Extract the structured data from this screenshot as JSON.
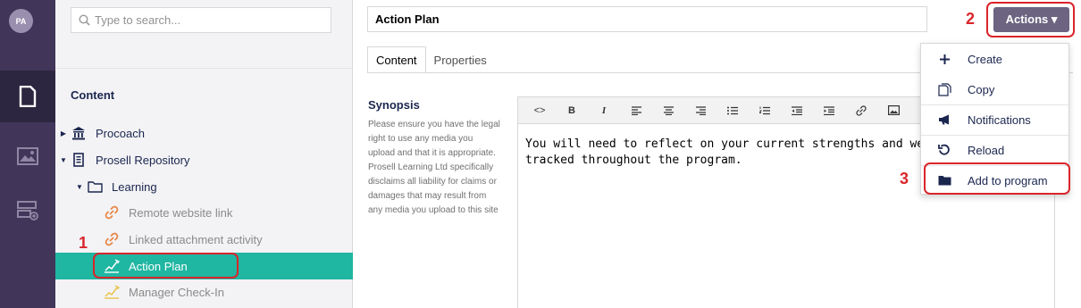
{
  "rail": {
    "avatar_initials": "PA",
    "items": [
      {
        "name": "content-section-icon",
        "active": true
      },
      {
        "name": "media-section-icon",
        "active": false
      },
      {
        "name": "settings-section-icon",
        "active": false
      }
    ]
  },
  "tree": {
    "search_placeholder": "Type to search...",
    "heading": "Content",
    "nodes": [
      {
        "label": "Procoach",
        "icon": "bank-icon"
      },
      {
        "label": "Prosell Repository",
        "icon": "building-icon"
      },
      {
        "label": "Learning",
        "icon": "folder-icon"
      },
      {
        "label": "Remote website link",
        "icon": "link-icon"
      },
      {
        "label": "Linked attachment activity",
        "icon": "link-icon"
      },
      {
        "label": "Action Plan",
        "icon": "pencil-chart-icon"
      },
      {
        "label": "Manager Check-In",
        "icon": "pencil-chart-icon"
      }
    ]
  },
  "editor": {
    "title_value": "Action Plan",
    "actions_label": "Actions ▾",
    "tabs": [
      "Content",
      "Properties"
    ],
    "synopsis_label": "Synopsis",
    "synopsis_help": "Please ensure you have the legal right to use any media you upload and that it is appropriate. Prosell Learning Ltd specifically disclaims all liability for claims or damages that may result from any media you upload to this site",
    "toolbar": [
      "<>",
      "B",
      "I",
      "align-left",
      "align-center",
      "align-right",
      "bullets",
      "numbers",
      "outdent",
      "indent",
      "link",
      "image",
      "embed"
    ],
    "body_text": "You will need to reflect on your current strengths and weaknesses s\ntracked throughout the program."
  },
  "menu": {
    "items": [
      {
        "label": "Create",
        "icon": "plus-icon"
      },
      {
        "label": "Copy",
        "icon": "copy-icon"
      },
      {
        "label": "Notifications",
        "icon": "megaphone-icon"
      },
      {
        "label": "Reload",
        "icon": "reload-icon"
      },
      {
        "label": "Add to program",
        "icon": "folder-icon"
      }
    ]
  },
  "annotations": {
    "step1": "1",
    "step2": "2",
    "step3": "3"
  },
  "colors": {
    "rail": "#413659",
    "selected_row": "#1fb6a2",
    "actions_button": "#6c6480",
    "annotation": "#d9252a"
  }
}
